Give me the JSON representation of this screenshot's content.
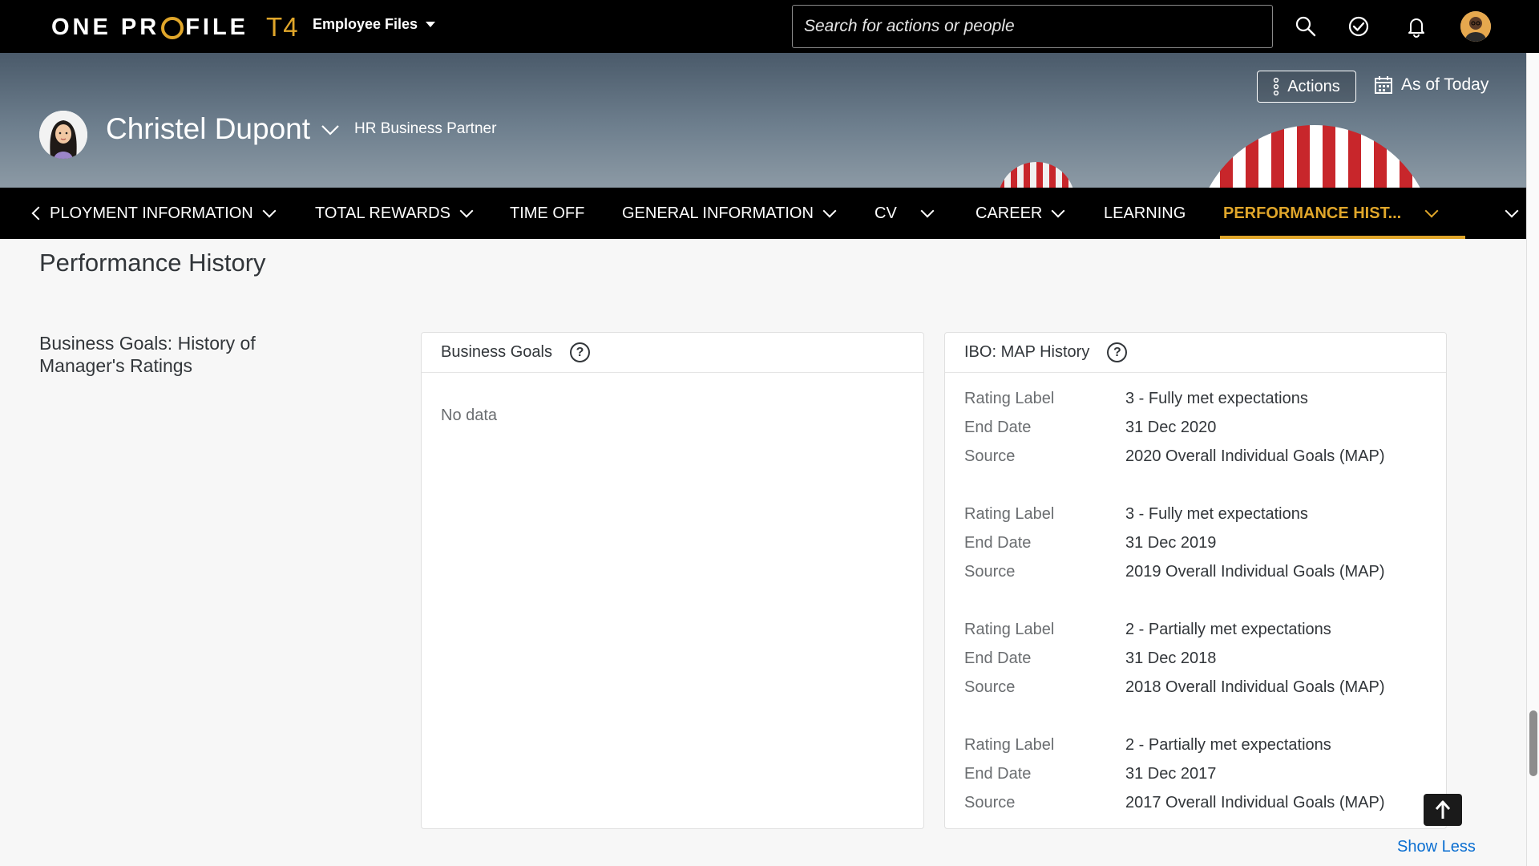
{
  "shell": {
    "logo_text": "ONE PROFILE",
    "logo_suffix": "T4",
    "app_menu_label": "Employee Files",
    "search_placeholder": "Search for actions or people"
  },
  "profile": {
    "name": "Christel Dupont",
    "role": "HR Business Partner",
    "actions_label": "Actions",
    "as_of_label": "As of Today"
  },
  "tabs": [
    {
      "label": "PLOYMENT INFORMATION",
      "has_menu": true
    },
    {
      "label": "TOTAL REWARDS",
      "has_menu": true
    },
    {
      "label": "TIME OFF",
      "has_menu": false
    },
    {
      "label": "GENERAL INFORMATION",
      "has_menu": true
    },
    {
      "label": "CV",
      "has_menu": true
    },
    {
      "label": "CAREER",
      "has_menu": true
    },
    {
      "label": "LEARNING",
      "has_menu": false
    },
    {
      "label": "PERFORMANCE HIST...",
      "has_menu": true,
      "active": true
    }
  ],
  "content": {
    "section_title": "Performance History",
    "group_label": "Business Goals: History of Manager's Ratings",
    "business_goals": {
      "title": "Business Goals",
      "empty_text": "No data"
    },
    "ibo_history": {
      "title": "IBO: MAP History",
      "labels": {
        "rating": "Rating Label",
        "end_date": "End Date",
        "source": "Source"
      },
      "records": [
        {
          "rating": "3 - Fully met expectations",
          "end_date": "31 Dec 2020",
          "source": "2020 Overall Individual Goals (MAP)"
        },
        {
          "rating": "3 - Fully met expectations",
          "end_date": "31 Dec 2019",
          "source": "2019 Overall Individual Goals (MAP)"
        },
        {
          "rating": "2 - Partially met expectations",
          "end_date": "31 Dec 2018",
          "source": "2018 Overall Individual Goals (MAP)"
        },
        {
          "rating": "2 - Partially met expectations",
          "end_date": "31 Dec 2017",
          "source": "2017 Overall Individual Goals (MAP)"
        }
      ]
    },
    "show_less_label": "Show Less"
  },
  "colors": {
    "accent": "#e0a62a",
    "link": "#0a6ed1",
    "shell_bg": "#000000"
  },
  "icons": [
    "search-icon",
    "approve-icon",
    "bell-icon",
    "user-avatar",
    "calendar-icon",
    "more-vertical-icon",
    "help-icon",
    "arrow-up-icon"
  ]
}
